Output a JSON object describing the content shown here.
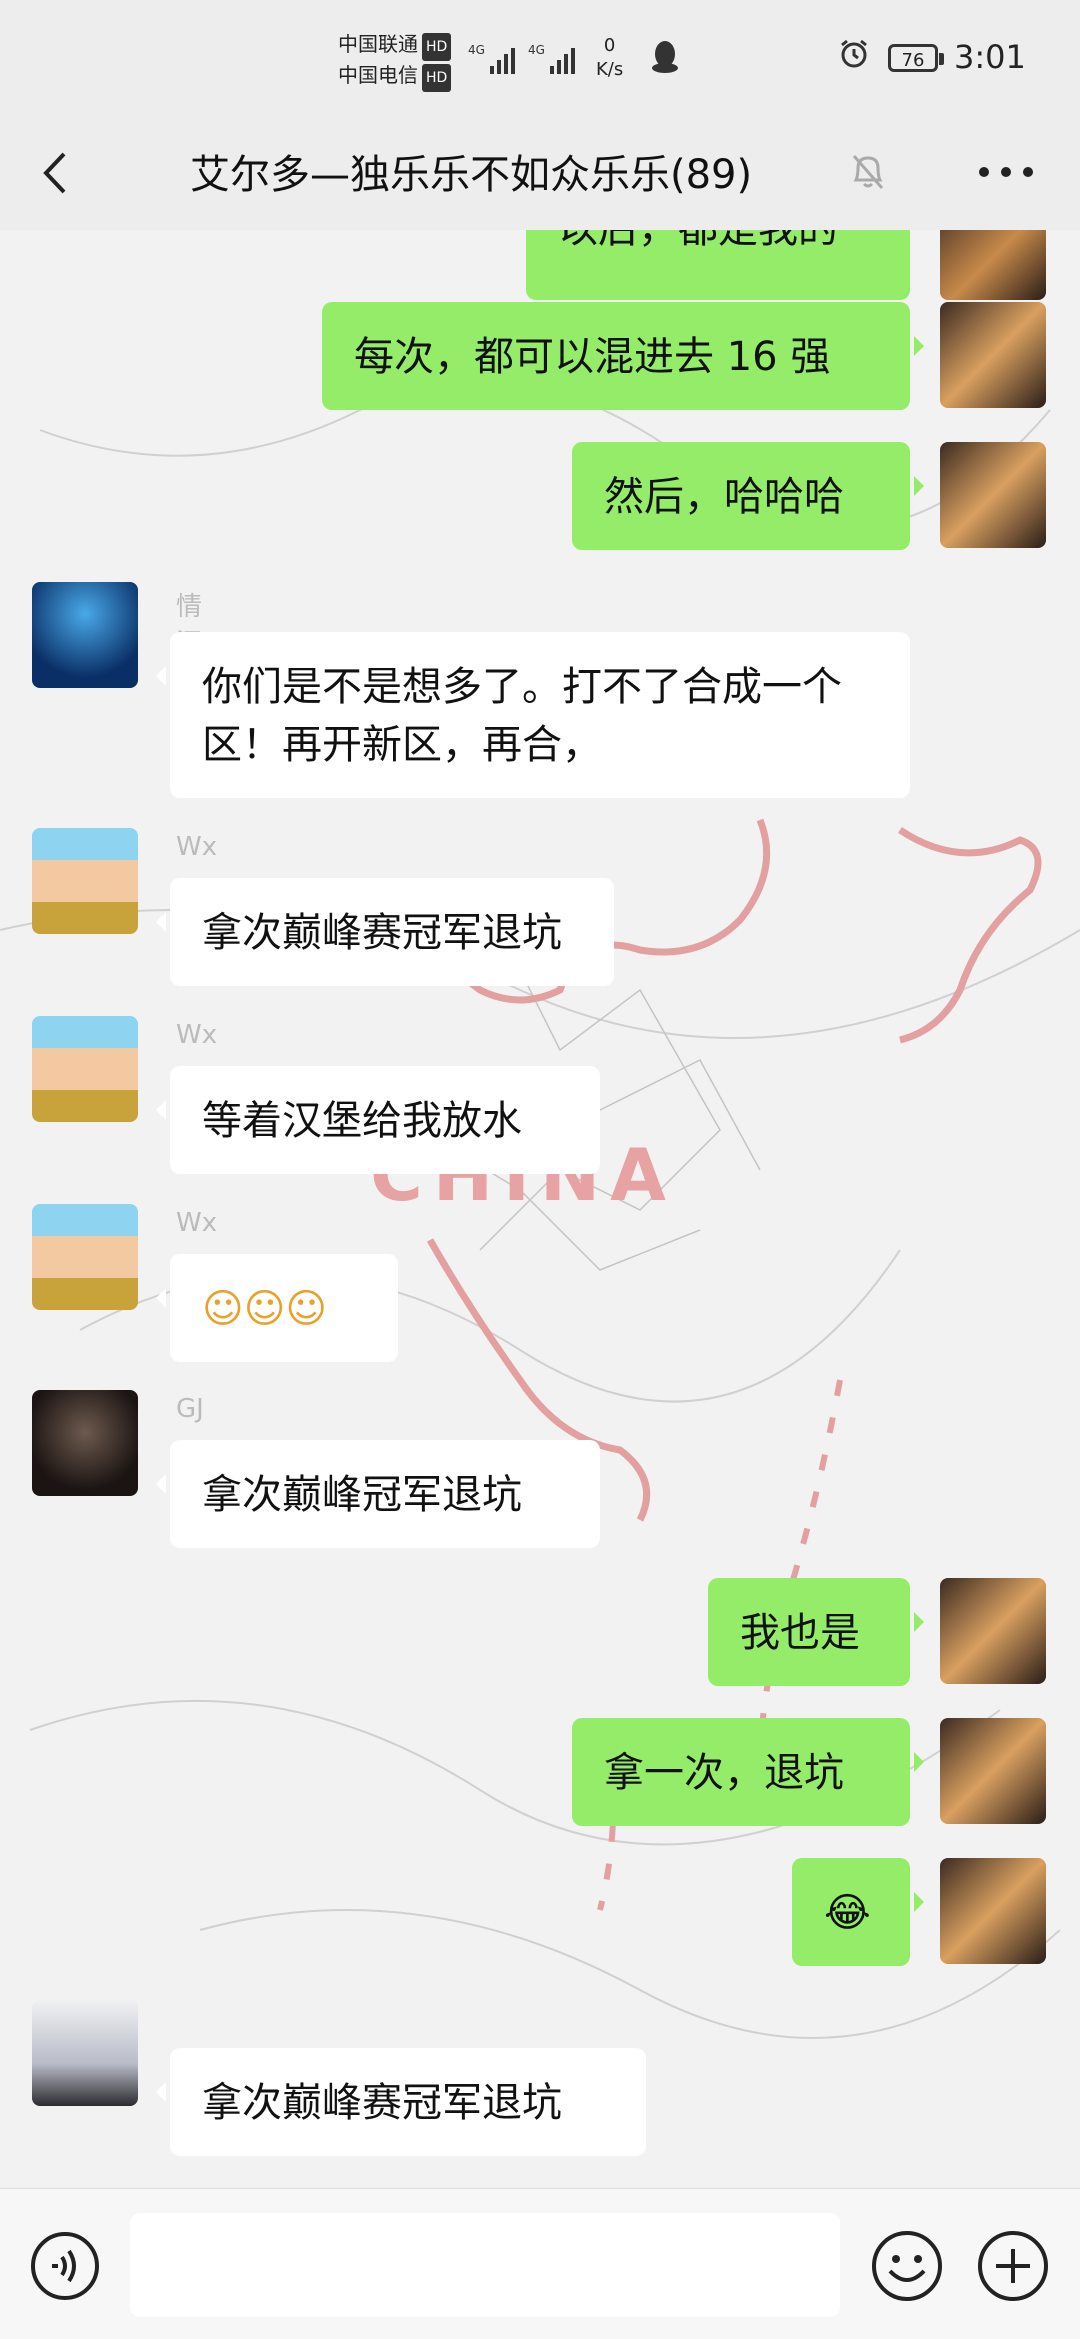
{
  "status_bar": {
    "carrier1": "中国联通",
    "carrier2": "中国电信",
    "hd_badge": "HD",
    "network": "4G",
    "net_speed_value": "0",
    "net_speed_unit": "K/s",
    "battery": "76",
    "time": "3:01"
  },
  "header": {
    "title": "艾尔多—独乐乐不如众乐乐(89)"
  },
  "messages": [
    {
      "side": "me",
      "text": "以后，都是我的"
    },
    {
      "side": "me",
      "text": "每次，都可以混进去 16 强"
    },
    {
      "side": "me",
      "text": "然后，哈哈哈"
    },
    {
      "side": "other",
      "sender": "情深，必定殇",
      "text": "你们是不是想多了。打不了合成一个区！再开新区，再合，"
    },
    {
      "side": "other",
      "sender": "Wx",
      "text": "拿次巅峰赛冠军退坑"
    },
    {
      "side": "other",
      "sender": "Wx",
      "text": "等着汉堡给我放水"
    },
    {
      "side": "other",
      "sender": "Wx",
      "text": "☺☺☺"
    },
    {
      "side": "other",
      "sender": "GJ",
      "text": "拿次巅峰冠军退坑"
    },
    {
      "side": "me",
      "text": "我也是"
    },
    {
      "side": "me",
      "text": "拿一次，退坑"
    },
    {
      "side": "me",
      "text": "😂"
    },
    {
      "side": "other",
      "sender": "",
      "text": "拿次巅峰赛冠军退坑"
    }
  ],
  "background_map_label": "CHINA",
  "icons": [
    "back-icon",
    "mute-bell-icon",
    "more-icon",
    "voice-icon",
    "emoji-icon",
    "plus-icon"
  ]
}
